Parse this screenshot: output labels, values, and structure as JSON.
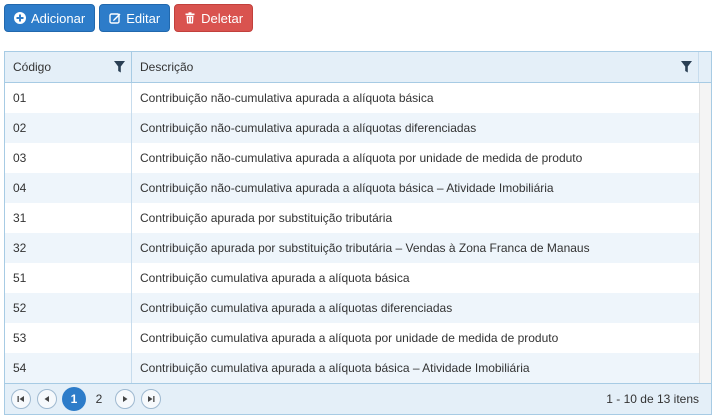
{
  "toolbar": {
    "add_label": "Adicionar",
    "edit_label": "Editar",
    "delete_label": "Deletar"
  },
  "grid": {
    "columns": {
      "code": "Código",
      "description": "Descrição"
    },
    "rows": [
      {
        "code": "01",
        "description": "Contribuição não-cumulativa apurada a alíquota básica"
      },
      {
        "code": "02",
        "description": "Contribuição não-cumulativa apurada a alíquotas diferenciadas"
      },
      {
        "code": "03",
        "description": "Contribuição não-cumulativa apurada a alíquota por unidade de medida de produto"
      },
      {
        "code": "04",
        "description": "Contribuição não-cumulativa apurada a alíquota básica – Atividade Imobiliária"
      },
      {
        "code": "31",
        "description": "Contribuição apurada por substituição tributária"
      },
      {
        "code": "32",
        "description": "Contribuição apurada por substituição tributária – Vendas à Zona Franca de Manaus"
      },
      {
        "code": "51",
        "description": "Contribuição cumulativa apurada a alíquota básica"
      },
      {
        "code": "52",
        "description": "Contribuição cumulativa apurada a alíquotas diferenciadas"
      },
      {
        "code": "53",
        "description": "Contribuição cumulativa apurada a alíquota por unidade de medida de produto"
      },
      {
        "code": "54",
        "description": "Contribuição cumulativa apurada a alíquota básica – Atividade Imobiliária"
      }
    ]
  },
  "pager": {
    "pages": [
      "1",
      "2"
    ],
    "current_page": "1",
    "info": "1 - 10 de 13 itens"
  },
  "colors": {
    "primary": "#2d7cc9",
    "danger": "#d9534f",
    "header_bg": "#e4eff8",
    "alt_row": "#eef5fb",
    "border": "#a7cbe4"
  },
  "icons": [
    "plus-circle-icon",
    "edit-icon",
    "trash-icon",
    "filter-icon",
    "first-page-icon",
    "prev-page-icon",
    "next-page-icon",
    "last-page-icon"
  ]
}
